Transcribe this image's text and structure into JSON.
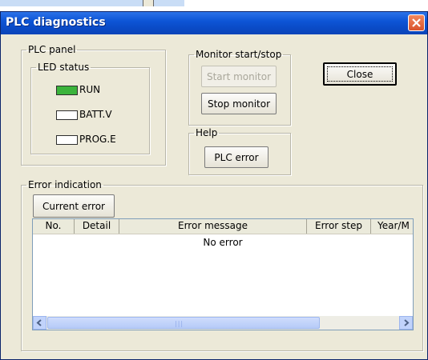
{
  "window": {
    "title": "PLC diagnostics"
  },
  "plc_panel": {
    "label": "PLC panel",
    "led_group_label": "LED status",
    "leds": [
      {
        "label": "RUN",
        "color": "#3bb33b"
      },
      {
        "label": "BATT.V",
        "color": "#ffffff"
      },
      {
        "label": "PROG.E",
        "color": "#ffffff"
      }
    ]
  },
  "monitor": {
    "label": "Monitor start/stop",
    "start_label": "Start monitor",
    "stop_label": "Stop monitor"
  },
  "help": {
    "label": "Help",
    "plc_error_label": "PLC error"
  },
  "close_label": "Close",
  "errors": {
    "label": "Error indication",
    "current_error_label": "Current error",
    "columns": [
      "No.",
      "Detail",
      "Error message",
      "Error step",
      "Year/M"
    ],
    "empty_message": "No error"
  }
}
